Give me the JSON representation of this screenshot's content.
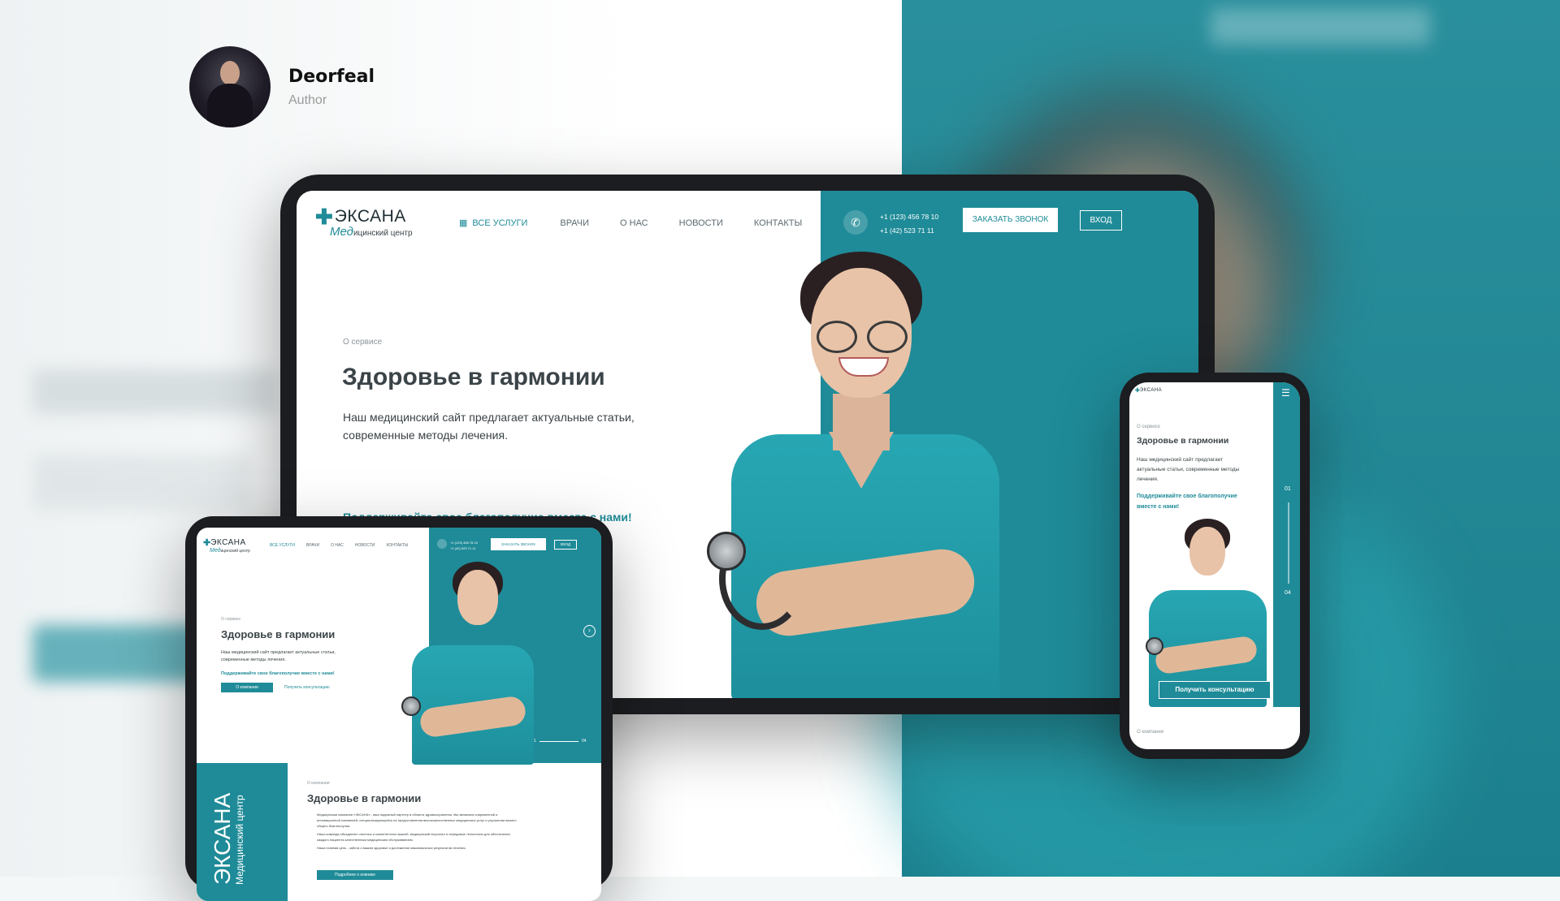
{
  "author": {
    "name": "Deorfeal",
    "role": "Author"
  },
  "site": {
    "logo": {
      "name": "ЭКСАНА",
      "sub_a": "Мед",
      "sub_b": "ицинский центр"
    },
    "nav": [
      "ВСЕ УСЛУГИ",
      "ВРАЧИ",
      "О НАС",
      "НОВОСТИ",
      "КОНТАКТЫ"
    ],
    "phones": [
      "+1 (123) 456 78 10",
      "+1 (42) 523 71 11"
    ],
    "call_button": "ЗАКАЗАТЬ ЗВОНОК",
    "login_button": "ВХОД",
    "hero": {
      "label": "О сервисе",
      "title": "Здоровье в гармонии",
      "lead_1": "Наш медицинский сайт предлагает актуальные статьи,",
      "lead_2": "современные методы лечения.",
      "accent": "Поддерживайте свое благополучие вместе с нами!",
      "slide_current": "01",
      "slide_last": "04"
    }
  },
  "small_tablet": {
    "nav_active": "ВСЕ УСЛУГИ",
    "phone_short": "+1 (123) 456 78 10",
    "label": "О сервисе",
    "title": "Здоровье в гармонии",
    "lead_1": "Наш медицинский сайт предлагает актуальные статьи,",
    "lead_2": "современные методы лечения.",
    "accent": "Поддерживайте свое благополучие вместе с нами!",
    "btn_about": "О компании",
    "btn_consult": "Получить консультацию",
    "slide_current": "01",
    "slide_last": "04",
    "about": {
      "side_logo": "ЭКСАНА",
      "side_sub": "Медицинский центр",
      "label": "О компании",
      "title": "Здоровье в гармонии",
      "p1": "Медицинская компания «ЭКСАНА» - ваш надежный партнер в области здравоохранения. Мы являемся современной и инновационной компанией, специализирующейся на предоставлении высококачественных медицинских услуг и улучшении вашего общего благополучия.",
      "p2": "Наша команда объединяет опытных и компетентных врачей, медицинский персонал и передовые технологии для обеспечения каждого пациента качественным медицинским обслуживанием.",
      "p3": "Наша главная цель - забота о вашем здоровье и достижение максимальных результатов лечения.",
      "btn": "Подробнее о клинике"
    }
  },
  "phone": {
    "label": "О сервисе",
    "title": "Здоровье в гармонии",
    "lead": "Наш медицинский сайт предлагает актуальные статьи, современные методы лечения.",
    "accent": "Поддерживайте свое благополучие вместе с нами!",
    "slide_current": "01",
    "slide_last": "04",
    "cta": "Получить консультацию",
    "footer_label": "О компании"
  },
  "colors": {
    "accent": "#1f8b98",
    "dark_text": "#3b4448",
    "frame": "#1c1d20"
  }
}
